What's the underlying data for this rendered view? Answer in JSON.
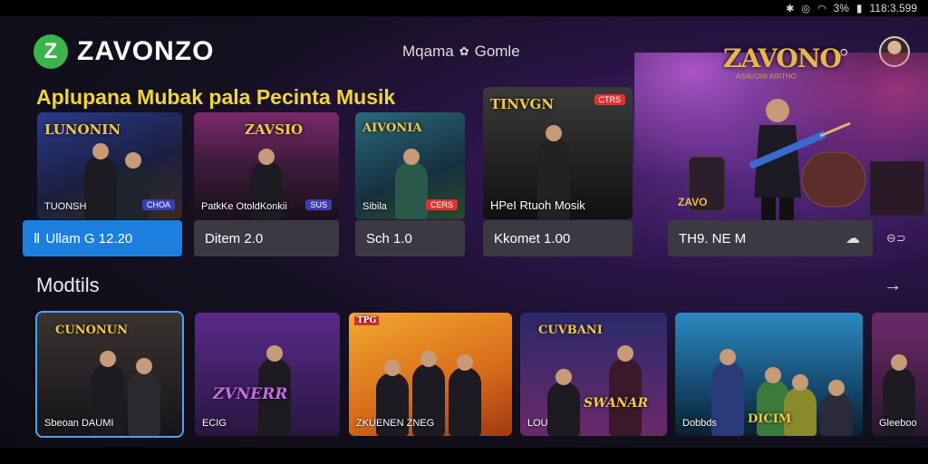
{
  "status_bar": {
    "time": "118:3.599",
    "battery": "3%",
    "icons": [
      "bluetooth-icon",
      "sync-icon",
      "wifi-icon"
    ]
  },
  "header": {
    "logo_letter": "Z",
    "logo_text": "ZAVONZO",
    "nav_left": "Mqama",
    "nav_right": "Gomle",
    "search_icon": "search-icon",
    "accent": "#3ab54a"
  },
  "hero": {
    "title": "ZAVONO",
    "subtitle": "ASAVONI AIRTHO",
    "badge": "ZAVO"
  },
  "section1": {
    "title": "Aplupana Mubak pala Pecinta Musik",
    "cards": [
      {
        "art_title": "LUNONIN",
        "art_label": "TUONSH",
        "tag": "CHOA",
        "meta": "Ullam G 12.20",
        "active": true,
        "meta_icon": "Ⅱ"
      },
      {
        "art_title": "ZAVSIO",
        "art_label": "PatkKe OtoldKonkii",
        "tag": "SUS",
        "meta": "Ditem 2.0",
        "active": false
      },
      {
        "art_title": "AIVONIA",
        "art_label": "Sibila",
        "tag": "CERS",
        "meta": "Sch 1.0",
        "active": false
      },
      {
        "art_title": "TINVGN",
        "art_label": "HPeI Rtuoh Mosik",
        "tag": "CTRS",
        "meta": "Kkomet 1.00",
        "active": false
      },
      {
        "art_label": "",
        "meta": "TH9. NE M",
        "active": false,
        "meta_icon": "cloud-icon"
      }
    ],
    "colors": {
      "active": "#1c7fe0",
      "inactive": "#3b3a42"
    }
  },
  "section2": {
    "title": "Modtils",
    "more_arrow": "→",
    "thumbs": [
      {
        "top": "CUNONUN",
        "label": "Sbeoan DAUMI",
        "selected": true
      },
      {
        "title": "ZVNERR",
        "label": "ECIG"
      },
      {
        "top": "TPG",
        "label": "ZKUENEN ZNEG"
      },
      {
        "top": "CUVBANI",
        "title": "SWANAR",
        "label": "LOU"
      },
      {
        "top": "",
        "label": "Dobbds",
        "title": "DICIM"
      },
      {
        "label": "Gleeboo"
      }
    ]
  }
}
